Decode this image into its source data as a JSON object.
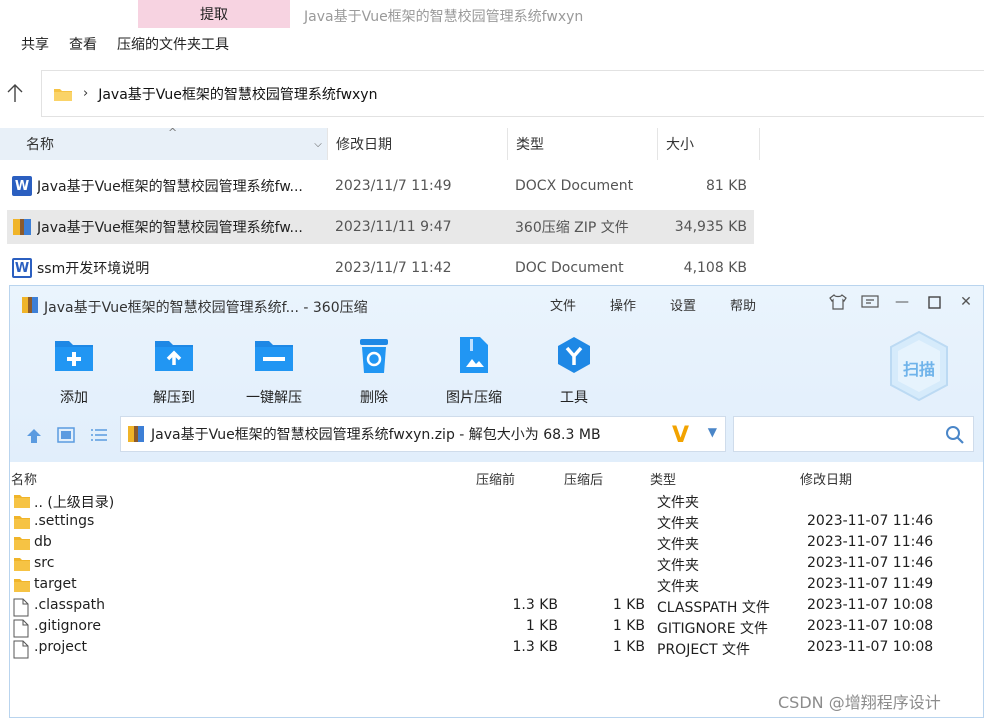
{
  "explorer": {
    "ribbon_context_tab": "提取",
    "window_title": "Java基于Vue框架的智慧校园管理系统fwxyn",
    "ribbon_tabs": [
      "共享",
      "查看",
      "压缩的文件夹工具"
    ],
    "address_path": "Java基于Vue框架的智慧校园管理系统fwxyn",
    "columns": {
      "name": "名称",
      "date": "修改日期",
      "type": "类型",
      "size": "大小"
    },
    "files": [
      {
        "name": "Java基于Vue框架的智慧校园管理系统fw...",
        "date": "2023/11/7 11:49",
        "type": "DOCX Document",
        "size": "81 KB",
        "icon": "word-docx-icon"
      },
      {
        "name": "Java基于Vue框架的智慧校园管理系统fw...",
        "date": "2023/11/11 9:47",
        "type": "360压缩 ZIP 文件",
        "size": "34,935 KB",
        "icon": "zip-archive-icon"
      },
      {
        "name": "ssm开发环境说明",
        "date": "2023/11/7 11:42",
        "type": "DOC Document",
        "size": "4,108 KB",
        "icon": "word-doc-icon"
      }
    ]
  },
  "zip": {
    "title": "Java基于Vue框架的智慧校园管理系统f... - 360压缩",
    "menu": [
      "文件",
      "操作",
      "设置",
      "帮助"
    ],
    "toolbar": [
      {
        "label": "添加",
        "icon": "add-icon"
      },
      {
        "label": "解压到",
        "icon": "extract-to-icon"
      },
      {
        "label": "一键解压",
        "icon": "one-click-extract-icon"
      },
      {
        "label": "删除",
        "icon": "delete-icon"
      },
      {
        "label": "图片压缩",
        "icon": "image-compress-icon"
      },
      {
        "label": "工具",
        "icon": "tools-icon"
      }
    ],
    "scan_label": "扫描",
    "address": "Java基于Vue框架的智慧校园管理系统fwxyn.zip - 解包大小为 68.3 MB",
    "columns": {
      "name": "名称",
      "before": "压缩前",
      "after": "压缩后",
      "type": "类型",
      "date": "修改日期"
    },
    "entries": [
      {
        "name": ".. (上级目录)",
        "before": "",
        "after": "",
        "type": "文件夹",
        "date": "",
        "kind": "folder"
      },
      {
        "name": ".settings",
        "before": "",
        "after": "",
        "type": "文件夹",
        "date": "2023-11-07 11:46",
        "kind": "folder"
      },
      {
        "name": "db",
        "before": "",
        "after": "",
        "type": "文件夹",
        "date": "2023-11-07 11:46",
        "kind": "folder"
      },
      {
        "name": "src",
        "before": "",
        "after": "",
        "type": "文件夹",
        "date": "2023-11-07 11:46",
        "kind": "folder"
      },
      {
        "name": "target",
        "before": "",
        "after": "",
        "type": "文件夹",
        "date": "2023-11-07 11:49",
        "kind": "folder"
      },
      {
        "name": ".classpath",
        "before": "1.3 KB",
        "after": "1 KB",
        "type": "CLASSPATH 文件",
        "date": "2023-11-07 10:08",
        "kind": "file"
      },
      {
        "name": ".gitignore",
        "before": "1 KB",
        "after": "1 KB",
        "type": "GITIGNORE 文件",
        "date": "2023-11-07 10:08",
        "kind": "file"
      },
      {
        "name": ".project",
        "before": "1.3 KB",
        "after": "1 KB",
        "type": "PROJECT 文件",
        "date": "2023-11-07 10:08",
        "kind": "file"
      }
    ]
  },
  "watermark": "CSDN @增翔程序设计",
  "colors": {
    "accent": "#2f8be0",
    "folder": "#f6c344",
    "ribbon_pink": "#f7d3e1"
  }
}
